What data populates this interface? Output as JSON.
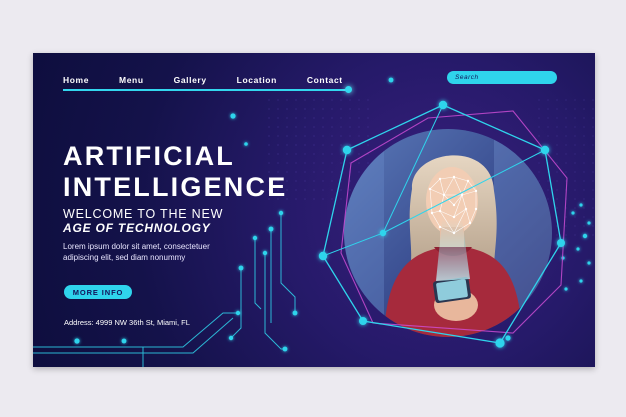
{
  "nav": {
    "items": [
      {
        "label": "Home"
      },
      {
        "label": "Menu"
      },
      {
        "label": "Gallery"
      },
      {
        "label": "Location"
      },
      {
        "label": "Contact"
      }
    ],
    "search_placeholder": "Search"
  },
  "hero": {
    "title_line1": "ARTIFICIAL",
    "title_line2": "INTELLIGENCE",
    "subtitle_line1": "WELCOME TO THE NEW",
    "subtitle_line2": "AGE OF TECHNOLOGY",
    "body": "Lorem ipsum dolor sit amet, consectetuer adipiscing elit, sed diam nonummy",
    "cta_label": "MORE INFO",
    "address": "Address: 4999 NW 36th St, Miami, FL"
  },
  "colors": {
    "accent": "#2fd4ec",
    "background_dark": "#14124a",
    "background_purple": "#3a1f7e",
    "magenta_line": "#d24fd8"
  },
  "icons": {
    "face_mesh": "face-mesh-icon",
    "circuit": "circuit-decoration"
  }
}
